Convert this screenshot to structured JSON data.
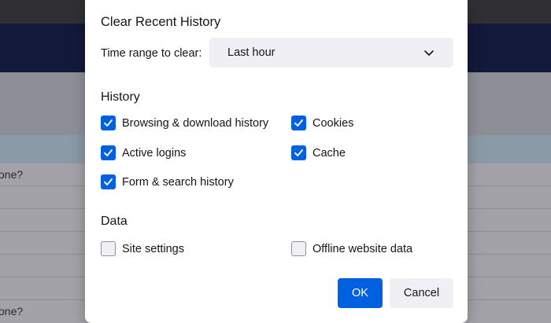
{
  "background": {
    "rows": [
      {
        "text": "one?"
      },
      {
        "text": ""
      },
      {
        "text": ""
      },
      {
        "text": ""
      },
      {
        "text": ""
      },
      {
        "text": ""
      },
      {
        "text": "one?"
      }
    ]
  },
  "dialog": {
    "title": "Clear Recent History",
    "time_range": {
      "label": "Time range to clear:",
      "selected": "Last hour"
    },
    "history": {
      "heading": "History",
      "items": [
        {
          "label": "Browsing & download history",
          "checked": true
        },
        {
          "label": "Cookies",
          "checked": true
        },
        {
          "label": "Active logins",
          "checked": true
        },
        {
          "label": "Cache",
          "checked": true
        },
        {
          "label": "Form & search history",
          "checked": true
        }
      ]
    },
    "data": {
      "heading": "Data",
      "items": [
        {
          "label": "Site settings",
          "checked": false
        },
        {
          "label": "Offline website data",
          "checked": false
        }
      ]
    },
    "buttons": {
      "ok": "OK",
      "cancel": "Cancel"
    }
  },
  "colors": {
    "accent": "#0061e0",
    "dialog_bg": "#ffffff",
    "select_bg": "#f0f0f4"
  }
}
